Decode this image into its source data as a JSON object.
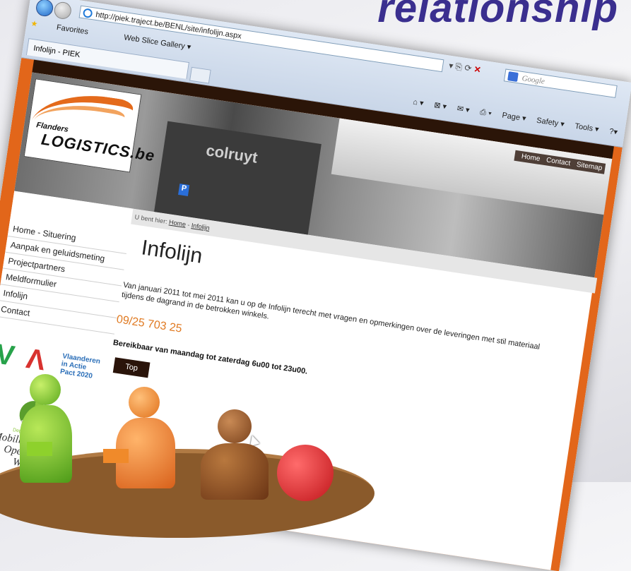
{
  "slide": {
    "title_fragment": "relationship"
  },
  "browser": {
    "url": "http://piek.traject.be/BENL/site/infolijn.aspx",
    "search_placeholder": "Google",
    "favorites_label": "Favorites",
    "web_slice_label": "Web Slice Gallery ▾",
    "tab_title": "Infolijn - PIEK",
    "command_bar": {
      "page": "Page ▾",
      "safety": "Safety ▾",
      "tools": "Tools ▾"
    }
  },
  "site": {
    "logo_line1": "Flanders",
    "logo_line2": "LOGISTICS.be",
    "banner_sign": "colruyt",
    "top_nav": [
      "Home",
      "Contact",
      "Sitemap"
    ],
    "sidebar_menu": [
      "Home - Situering",
      "Aanpak en geluidsmeting",
      "Projectpartners",
      "Meldformulier",
      "Infolijn",
      "Contact"
    ],
    "via_text": [
      "Vlaanderen",
      "in Actie",
      "Pact 2020"
    ],
    "mob_dep": "Departement",
    "mob_text1": "Mobiliteit en",
    "mob_text2": "Openbare Werken",
    "breadcrumb_prefix": "U bent hier:",
    "breadcrumb_home": "Home",
    "breadcrumb_sep": " - ",
    "breadcrumb_current": "Infolijn",
    "page_title": "Infolijn",
    "intro": "Van januari 2011 tot mei 2011 kan u op de Infolijn terecht met vragen en opmerkingen over de leveringen met stil materiaal tijdens de dagrand in de betrokken winkels.",
    "phone": "09/25 703 25",
    "hours": "Bereikbaar van maandag tot zaterdag 6u00 tot 23u00.",
    "top_button": "Top"
  },
  "colors": {
    "accent_orange": "#e2661a",
    "dark_brown": "#2b1508",
    "title_purple": "#3a2f8f"
  }
}
